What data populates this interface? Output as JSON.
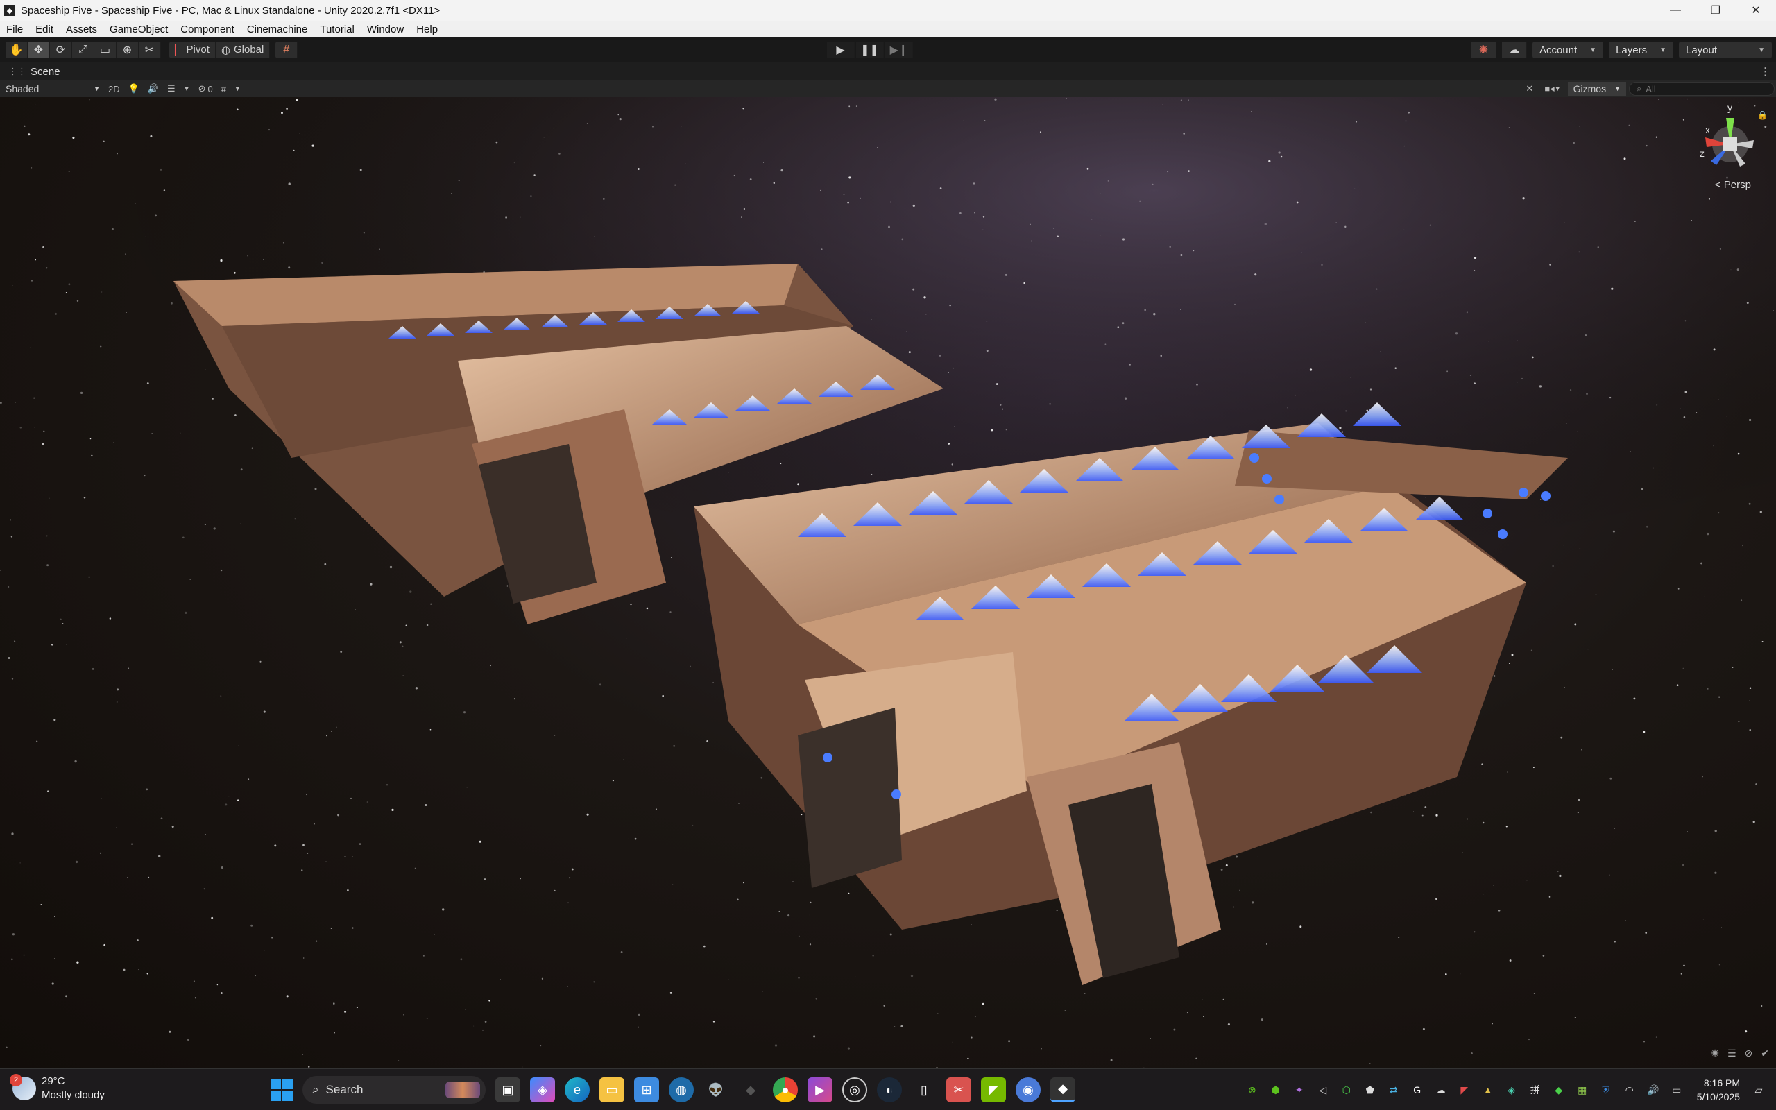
{
  "window": {
    "title": "Spaceship Five - Spaceship Five - PC, Mac & Linux Standalone - Unity 2020.2.7f1 <DX11>",
    "controls": [
      "—",
      "❐",
      "✕"
    ]
  },
  "menu": [
    "File",
    "Edit",
    "Assets",
    "GameObject",
    "Component",
    "Cinemachine",
    "Tutorial",
    "Window",
    "Help"
  ],
  "toolbar": {
    "pivot_label": "Pivot",
    "global_label": "Global",
    "account_label": "Account",
    "layers_label": "Layers",
    "layout_label": "Layout"
  },
  "scene": {
    "tab_label": "Scene",
    "shading_mode": "Shaded",
    "mode_2d_label": "2D",
    "hidden_count": "0",
    "gizmos_label": "Gizmos",
    "search_placeholder": "All",
    "projection_label": "< Persp",
    "axis_labels": {
      "y": "y",
      "x": "x",
      "z": "z"
    }
  },
  "taskbar": {
    "weather_temp": "29°C",
    "weather_desc": "Mostly cloudy",
    "weather_badge": "2",
    "search_label": "Search",
    "time": "8:16 PM",
    "date": "5/10/2025"
  },
  "colors": {
    "accent": "#2aa0f0",
    "hull": "#b98a6a",
    "glow": "#6f8cff"
  }
}
